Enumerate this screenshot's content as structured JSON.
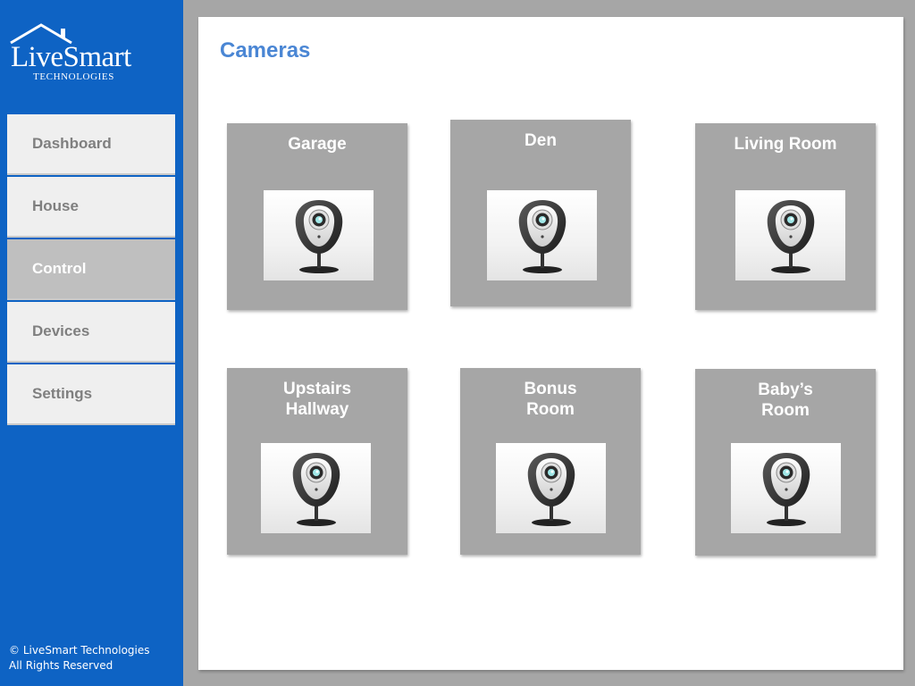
{
  "brand": {
    "name": "LiveSmart",
    "tagline": "TECHNOLOGIES",
    "color": "#0e63c4"
  },
  "nav": {
    "items": [
      {
        "label": "Dashboard",
        "active": false
      },
      {
        "label": "House",
        "active": false
      },
      {
        "label": "Control",
        "active": true
      },
      {
        "label": "Devices",
        "active": false
      },
      {
        "label": "Settings",
        "active": false
      }
    ]
  },
  "footer": {
    "copyright": "© LiveSmart Technologies",
    "rights": "All Rights Reserved"
  },
  "page": {
    "title": "Cameras",
    "title_color": "#4a86d4"
  },
  "cameras": [
    {
      "label": "Garage",
      "icon": "webcam-icon"
    },
    {
      "label": "Den",
      "icon": "webcam-icon"
    },
    {
      "label": "Living Room",
      "icon": "webcam-icon"
    },
    {
      "label": "Upstairs\nHallway",
      "icon": "webcam-icon"
    },
    {
      "label": "Bonus\nRoom",
      "icon": "webcam-icon"
    },
    {
      "label": "Baby’s\nRoom",
      "icon": "webcam-icon"
    }
  ]
}
